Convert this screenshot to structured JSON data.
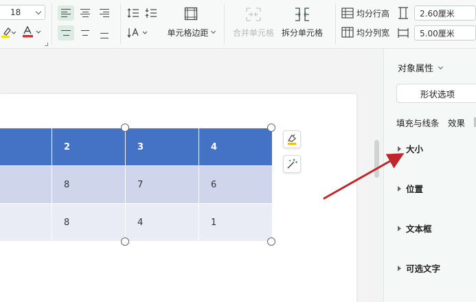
{
  "ribbon": {
    "font_size": "18",
    "merge_cells": "合并单元格",
    "split_cells": "拆分单元格",
    "cell_margins": "单元格边距",
    "distribute_rows": "均分行高",
    "distribute_cols": "均分列宽",
    "row_height": "2.60厘米",
    "col_width": "5.00厘米"
  },
  "colors": {
    "header_fill": "#4472c4",
    "row1_fill": "#cfd5ea",
    "row2_fill": "#e9ebf5",
    "arrow": "#c0262a",
    "highlight_yellow": "#f2e200",
    "font_red": "#d32f2f"
  },
  "table": {
    "header": [
      "",
      "2",
      "3",
      "4"
    ],
    "rows": [
      [
        "",
        "8",
        "7",
        "6"
      ],
      [
        "",
        "8",
        "4",
        "1"
      ]
    ]
  },
  "panel": {
    "title": "对象属性",
    "tab_shape": "形状选项",
    "sub_fill_line": "填充与线条",
    "sub_effect": "效果",
    "sections": [
      "大小",
      "位置",
      "文本框",
      "可选文字"
    ]
  },
  "icons": [
    "align-left-icon",
    "align-center-icon",
    "align-right-icon",
    "line-spacing-icon",
    "para-spacing-icon",
    "cell-margin-icon",
    "merge-cells-icon",
    "split-cells-icon",
    "distribute-rows-icon",
    "distribute-cols-icon",
    "highlight-icon",
    "font-color-icon",
    "text-direction-icon",
    "table-style-icon",
    "magic-wand-icon"
  ]
}
